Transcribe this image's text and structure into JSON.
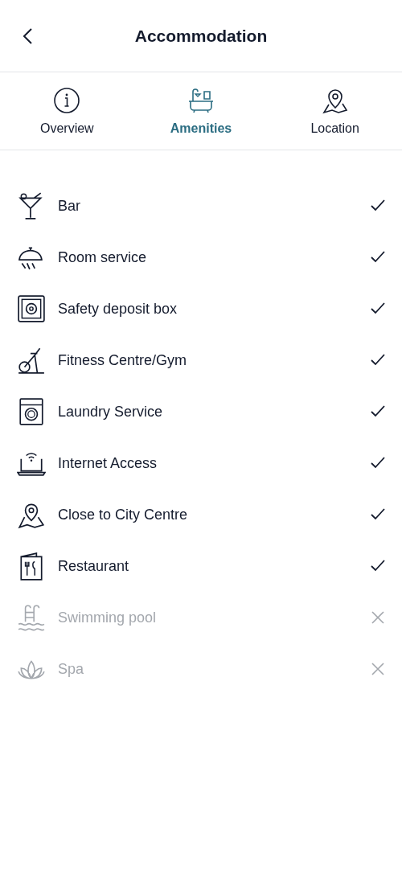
{
  "header": {
    "title": "Accommodation"
  },
  "tabs": [
    {
      "label": "Overview",
      "selected": false
    },
    {
      "label": "Amenities",
      "selected": true
    },
    {
      "label": "Location",
      "selected": false
    }
  ],
  "amenities": [
    {
      "name": "Bar",
      "available": true
    },
    {
      "name": "Room service",
      "available": true
    },
    {
      "name": "Safety deposit box",
      "available": true
    },
    {
      "name": "Fitness Centre/Gym",
      "available": true
    },
    {
      "name": "Laundry Service",
      "available": true
    },
    {
      "name": "Internet Access",
      "available": true
    },
    {
      "name": "Close to City Centre",
      "available": true
    },
    {
      "name": "Restaurant",
      "available": true
    },
    {
      "name": "Swimming pool",
      "available": false
    },
    {
      "name": "Spa",
      "available": false
    }
  ]
}
